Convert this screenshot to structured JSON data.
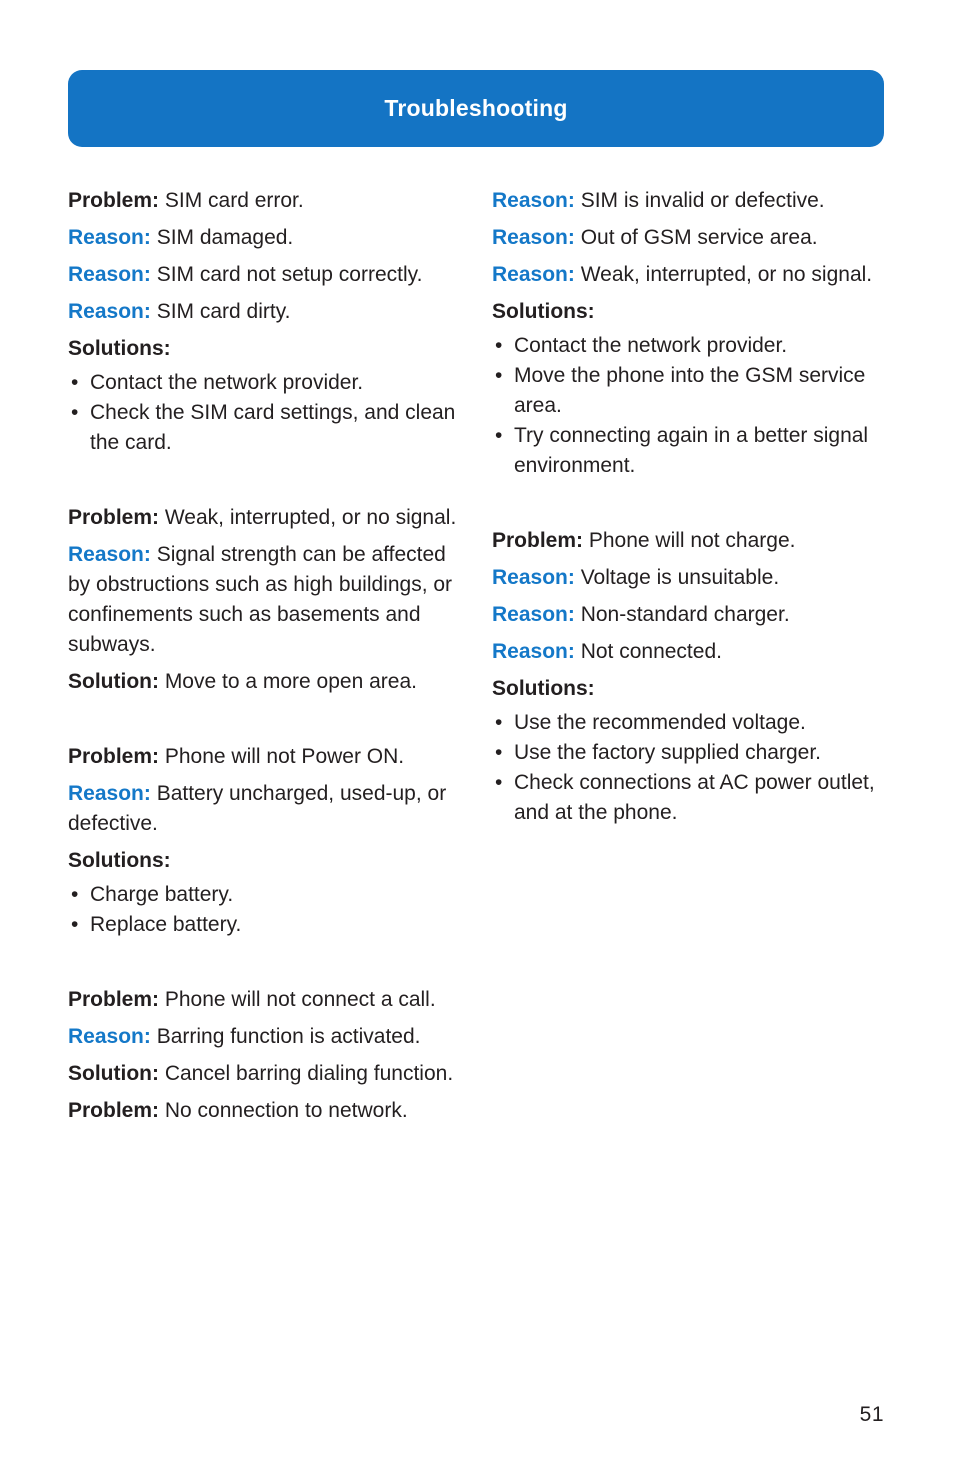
{
  "header": {
    "title": "Troubleshooting",
    "banner_color": "#1474c4",
    "title_color": "#ffffff"
  },
  "theme": {
    "reason_label_color": "#1478c8",
    "text_color": "#231f20",
    "page_background": "#ffffff",
    "bullet_glyph": "•"
  },
  "footer": {
    "page_number": "51"
  },
  "columns": {
    "left": [
      {
        "lines": [
          {
            "label": "Problem:",
            "label_style": "black",
            "text": "SIM card error."
          },
          {
            "label": "Reason:",
            "label_style": "blue",
            "text": "SIM damaged."
          },
          {
            "label": "Reason:",
            "label_style": "blue",
            "text": "SIM card not setup correctly."
          },
          {
            "label": "Reason:",
            "label_style": "blue",
            "text": "SIM card dirty."
          }
        ],
        "heading": "Solutions:",
        "bullets": [
          "Contact the network provider.",
          "Check the SIM card settings, and clean the card."
        ]
      },
      {
        "lines": [
          {
            "label": "Problem:",
            "label_style": "black",
            "text": "Weak, interrupted, or no signal."
          },
          {
            "label": "Reason:",
            "label_style": "blue",
            "text": "Signal strength can be affected by obstructions such as high buildings, or confinements such as basements and subways."
          },
          {
            "label": "Solution:",
            "label_style": "black",
            "text": "Move to a more open area."
          }
        ],
        "heading": "",
        "bullets": []
      },
      {
        "lines": [
          {
            "label": "Problem:",
            "label_style": "black",
            "text": "Phone will not Power ON."
          },
          {
            "label": "Reason:",
            "label_style": "blue",
            "text": "Battery uncharged, used-up, or defective."
          }
        ],
        "heading": "Solutions:",
        "bullets": [
          "Charge battery.",
          "Replace battery."
        ]
      },
      {
        "lines": [
          {
            "label": "Problem:",
            "label_style": "black",
            "text": "Phone will not connect a call."
          },
          {
            "label": "Reason:",
            "label_style": "blue",
            "text": "Barring function is activated."
          },
          {
            "label": "Solution:",
            "label_style": "black",
            "text": "Cancel barring dialing function."
          },
          {
            "label": "Problem:",
            "label_style": "black",
            "text": "No connection to network."
          }
        ],
        "heading": "",
        "bullets": []
      }
    ],
    "right": [
      {
        "lines": [
          {
            "label": "Reason:",
            "label_style": "blue",
            "text": "SIM is invalid or defective."
          },
          {
            "label": "Reason:",
            "label_style": "blue",
            "text": "Out of GSM service area."
          },
          {
            "label": "Reason:",
            "label_style": "blue",
            "text": "Weak, interrupted, or no signal."
          }
        ],
        "heading": "Solutions:",
        "bullets": [
          "Contact the network provider.",
          "Move the phone into the GSM service area.",
          "Try connecting again in a better signal environment."
        ]
      },
      {
        "lines": [
          {
            "label": "Problem:",
            "label_style": "black",
            "text": "Phone will not charge."
          },
          {
            "label": "Reason:",
            "label_style": "blue",
            "text": "Voltage is unsuitable."
          },
          {
            "label": "Reason:",
            "label_style": "blue",
            "text": "Non-standard charger."
          },
          {
            "label": "Reason:",
            "label_style": "blue",
            "text": "Not connected."
          }
        ],
        "heading": "Solutions:",
        "bullets": [
          "Use the recommended voltage.",
          "Use the factory supplied charger.",
          "Check connections at AC power outlet, and at the phone."
        ]
      }
    ]
  }
}
